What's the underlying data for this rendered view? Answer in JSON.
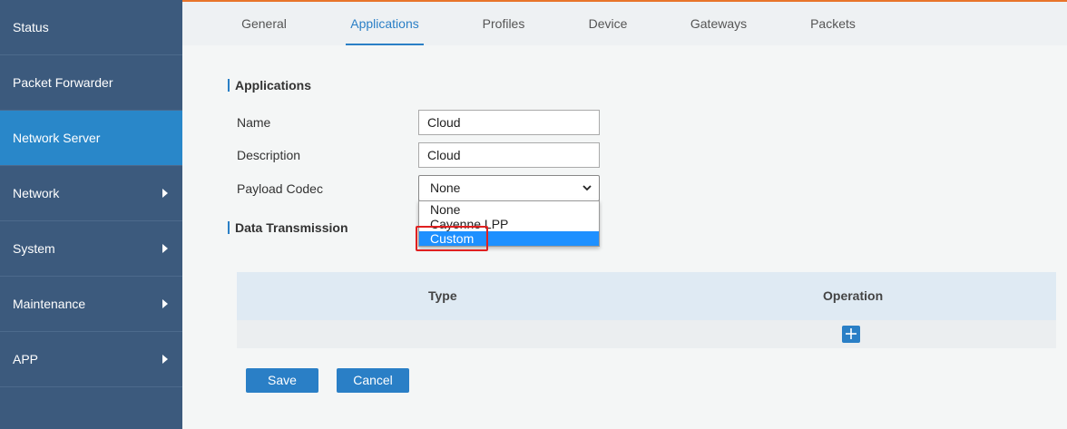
{
  "sidebar": {
    "items": [
      {
        "label": "Status"
      },
      {
        "label": "Packet Forwarder"
      },
      {
        "label": "Network Server"
      },
      {
        "label": "Network"
      },
      {
        "label": "System"
      },
      {
        "label": "Maintenance"
      },
      {
        "label": "APP"
      }
    ]
  },
  "tabs": [
    {
      "label": "General"
    },
    {
      "label": "Applications"
    },
    {
      "label": "Profiles"
    },
    {
      "label": "Device"
    },
    {
      "label": "Gateways"
    },
    {
      "label": "Packets"
    }
  ],
  "form": {
    "section_applications": "Applications",
    "name_label": "Name",
    "name_value": "Cloud",
    "description_label": "Description",
    "description_value": "Cloud",
    "payload_codec_label": "Payload Codec",
    "payload_codec_value": "None",
    "payload_codec_options": [
      {
        "label": "None"
      },
      {
        "label": "Cayenne LPP"
      },
      {
        "label": "Custom"
      }
    ],
    "section_data_transmission": "Data Transmission"
  },
  "table": {
    "col_type": "Type",
    "col_operation": "Operation"
  },
  "actions": {
    "save_label": "Save",
    "cancel_label": "Cancel"
  },
  "colors": {
    "sidebar_bg": "#3c5a7d",
    "sidebar_active": "#2987c9",
    "accent": "#2a7fc6",
    "top_line": "#e8742a",
    "highlight_box": "#e02020"
  }
}
